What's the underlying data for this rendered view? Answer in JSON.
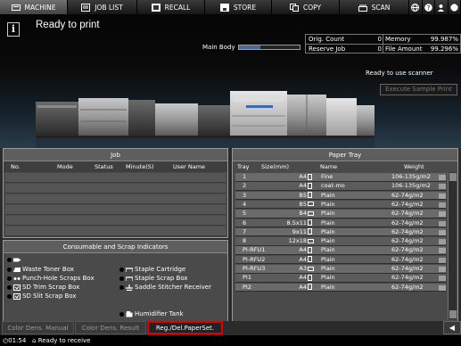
{
  "tabs": [
    {
      "label": "MACHINE",
      "icon": "machine-icon",
      "active": true
    },
    {
      "label": "JOB LIST",
      "icon": "job-list-icon",
      "active": false
    },
    {
      "label": "RECALL",
      "icon": "recall-icon",
      "active": false
    },
    {
      "label": "STORE",
      "icon": "store-icon",
      "active": false
    },
    {
      "label": "COPY",
      "icon": "copy-icon",
      "active": false
    },
    {
      "label": "SCAN",
      "icon": "scan-icon",
      "active": false
    }
  ],
  "tab_icons": [
    "globe-icon",
    "help-icon",
    "user-icon",
    "stop-icon"
  ],
  "status": {
    "title": "Ready to print",
    "main_body_label": "Main Body",
    "main_body_level": 0.35,
    "ready_scanner": "Ready to use scanner",
    "execute_sample_print": "Execute Sample Print"
  },
  "counters": {
    "orig_count_label": "Orig. Count",
    "orig_count_value": "0",
    "reserve_job_label": "Reserve Job",
    "reserve_job_value": "0",
    "memory_label": "Memory",
    "memory_value": "99.987%",
    "file_amount_label": "File Amount",
    "file_amount_value": "99.296%"
  },
  "job": {
    "title": "Job",
    "headers": {
      "no": "No.",
      "mode": "Mode",
      "status": "Status",
      "minutes": "Minute(S)",
      "user": "User Name"
    },
    "rows": [
      "",
      "",
      "",
      "",
      "",
      ""
    ]
  },
  "consumables": {
    "title": "Consumable and Scrap Indicators",
    "left": [
      "",
      "Waste Toner Box",
      "Punch-Hole Scraps Box",
      "SD Trim Scrap Box",
      "SD Slit Scrap Box"
    ],
    "right": [
      "Staple Cartridge",
      "Staple Scrap Box",
      "Saddle Stitcher Receiver"
    ],
    "bottom": "Humidifier Tank"
  },
  "paper_tray": {
    "title": "Paper Tray",
    "headers": {
      "tray": "Tray",
      "size": "Size(mm)",
      "name": "Name",
      "weight": "Weight"
    },
    "rows": [
      {
        "tray": "1",
        "size": "A4",
        "orient": "portrait",
        "name": "Fine",
        "weight": "106-135g/m2"
      },
      {
        "tray": "2",
        "size": "A4",
        "orient": "portrait",
        "name": "coat-mo",
        "weight": "106-135g/m2"
      },
      {
        "tray": "3",
        "size": "B5",
        "orient": "portrait",
        "name": "Plain",
        "weight": "62-74g/m2"
      },
      {
        "tray": "4",
        "size": "B5",
        "orient": "landscape",
        "name": "Plain",
        "weight": "62-74g/m2"
      },
      {
        "tray": "5",
        "size": "B4",
        "orient": "landscape",
        "name": "Plain",
        "weight": "62-74g/m2"
      },
      {
        "tray": "6",
        "size": "8.5x11",
        "orient": "portrait",
        "name": "Plain",
        "weight": "62-74g/m2"
      },
      {
        "tray": "7",
        "size": "9x11",
        "orient": "portrait",
        "name": "Plain",
        "weight": "62-74g/m2"
      },
      {
        "tray": "8",
        "size": "12x18",
        "orient": "landscape",
        "name": "Plain",
        "weight": "62-74g/m2"
      },
      {
        "tray": "PI-RFU1",
        "size": "A4",
        "orient": "portrait",
        "name": "Plain",
        "weight": "62-74g/m2"
      },
      {
        "tray": "PI-RFU2",
        "size": "A4",
        "orient": "portrait",
        "name": "Plain",
        "weight": "62-74g/m2"
      },
      {
        "tray": "PI-RFU3",
        "size": "A3",
        "orient": "landscape",
        "name": "Plain",
        "weight": "62-74g/m2"
      },
      {
        "tray": "PI1",
        "size": "A4",
        "orient": "portrait",
        "name": "Plain",
        "weight": "62-74g/m2"
      },
      {
        "tray": "PI2",
        "size": "A4",
        "orient": "portrait",
        "name": "Plain",
        "weight": "62-74g/m2"
      }
    ]
  },
  "bottom_tabs": [
    {
      "label": "Color Dens. Manual",
      "active": false
    },
    {
      "label": "Color Dens. Result",
      "active": false
    },
    {
      "label": "Reg./Del.PaperSet.",
      "active": true
    }
  ],
  "footer": {
    "time": "01:54",
    "message": "Ready to receive"
  },
  "colors": {
    "highlight": "#e00000",
    "accent": "#4a6a9c"
  }
}
